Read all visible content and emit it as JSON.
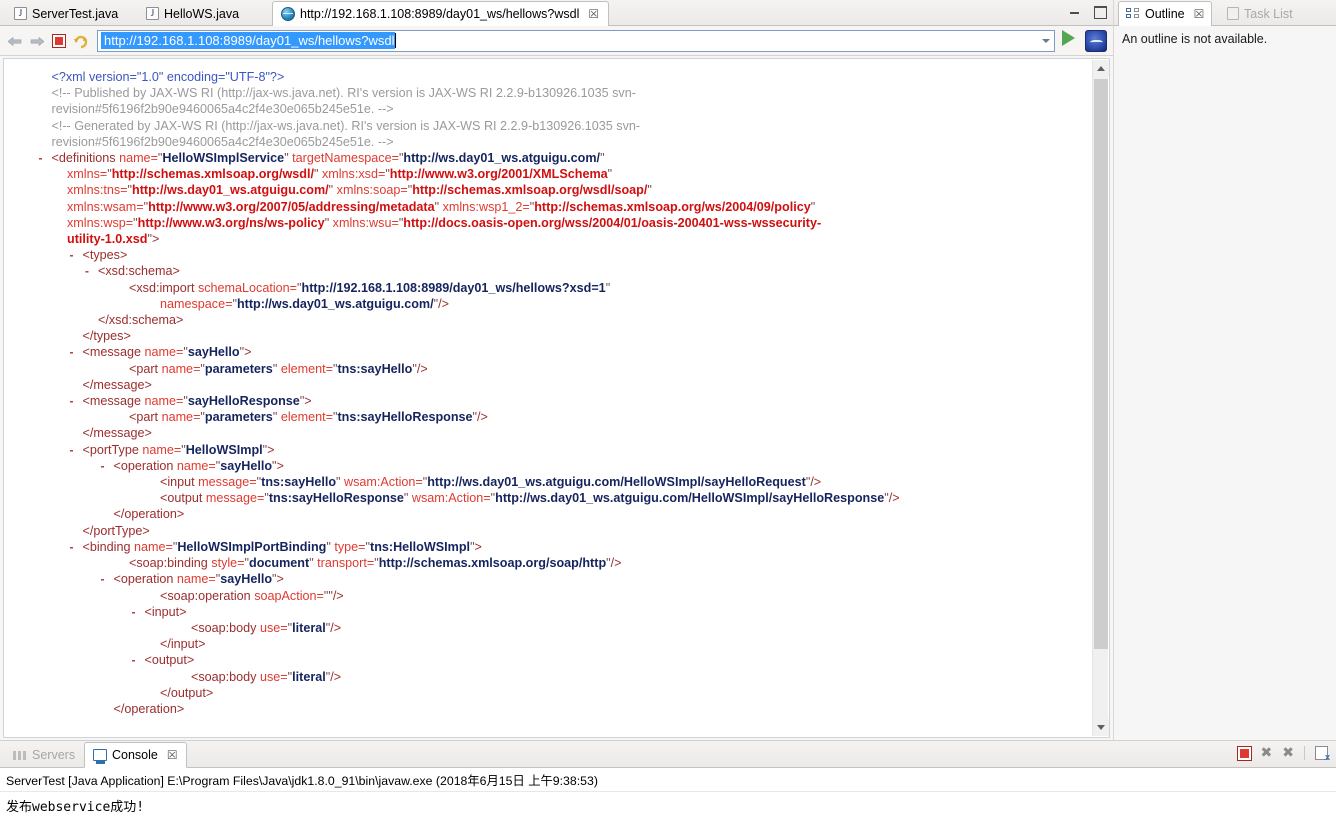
{
  "editor": {
    "tabs": [
      {
        "label": "ServerTest.java",
        "icon": "java-file-icon",
        "active": false,
        "closable": false
      },
      {
        "label": "HelloWS.java",
        "icon": "java-file-icon",
        "active": false,
        "closable": false
      },
      {
        "label": "http://192.168.1.108:8989/day01_ws/hellows?wsdl",
        "icon": "web-browser-icon",
        "active": true,
        "closable": true
      }
    ],
    "close_glyph": "☒"
  },
  "window_controls": {
    "minimize": "minimize-icon",
    "maximize": "maximize-icon"
  },
  "browser": {
    "back": "back-arrow-icon",
    "forward": "forward-arrow-icon",
    "stop": "stop-icon",
    "refresh": "refresh-icon",
    "address_value": "http://192.168.1.108:8989/day01_ws/hellows?wsdl",
    "address_dropdown": "chevron-down-icon",
    "go": "go-play-icon",
    "open_external": "open-in-browser-icon"
  },
  "xml": {
    "lines": [
      {
        "indent": 1,
        "collapse": "",
        "parts": [
          {
            "t": "<?xml version=\"1.0\" encoding=\"UTF-8\"?>",
            "c": "decl"
          }
        ]
      },
      {
        "indent": 1,
        "collapse": "",
        "parts": [
          {
            "t": "<!-- Published by JAX-WS RI (http://jax-ws.java.net). RI's version is JAX-WS RI 2.2.9-b130926.1035 svn-",
            "c": "cm"
          }
        ]
      },
      {
        "indent": 1,
        "collapse": "",
        "parts": [
          {
            "t": "revision#5f6196f2b90e9460065a4c2f4e30e065b245e51e. -->",
            "c": "cm"
          }
        ]
      },
      {
        "indent": 1,
        "collapse": "",
        "parts": [
          {
            "t": "<!-- Generated by JAX-WS RI (http://jax-ws.java.net). RI's version is JAX-WS RI 2.2.9-b130926.1035 svn-",
            "c": "cm"
          }
        ]
      },
      {
        "indent": 1,
        "collapse": "",
        "parts": [
          {
            "t": "revision#5f6196f2b90e9460065a4c2f4e30e065b245e51e. -->",
            "c": "cm"
          }
        ]
      },
      {
        "indent": 1,
        "collapse": "-",
        "parts": [
          {
            "t": "<definitions ",
            "c": "tg"
          },
          {
            "t": "name=",
            "c": "at"
          },
          {
            "t": "\"",
            "c": "qt"
          },
          {
            "t": "HelloWSImplService",
            "c": "vb"
          },
          {
            "t": "\" ",
            "c": "qt"
          },
          {
            "t": "targetNamespace=",
            "c": "at"
          },
          {
            "t": "\"",
            "c": "qt"
          },
          {
            "t": "http://ws.day01_ws.atguigu.com/",
            "c": "vb"
          },
          {
            "t": "\"",
            "c": "qt"
          }
        ]
      },
      {
        "indent": 2,
        "collapse": "",
        "parts": [
          {
            "t": "xmlns=",
            "c": "at"
          },
          {
            "t": "\"",
            "c": "qt"
          },
          {
            "t": "http://schemas.xmlsoap.org/wsdl/",
            "c": "vl"
          },
          {
            "t": "\" ",
            "c": "qt"
          },
          {
            "t": "xmlns:xsd=",
            "c": "at"
          },
          {
            "t": "\"",
            "c": "qt"
          },
          {
            "t": "http://www.w3.org/2001/XMLSchema",
            "c": "vl"
          },
          {
            "t": "\"",
            "c": "qt"
          }
        ]
      },
      {
        "indent": 2,
        "collapse": "",
        "parts": [
          {
            "t": "xmlns:tns=",
            "c": "at"
          },
          {
            "t": "\"",
            "c": "qt"
          },
          {
            "t": "http://ws.day01_ws.atguigu.com/",
            "c": "vl"
          },
          {
            "t": "\" ",
            "c": "qt"
          },
          {
            "t": "xmlns:soap=",
            "c": "at"
          },
          {
            "t": "\"",
            "c": "qt"
          },
          {
            "t": "http://schemas.xmlsoap.org/wsdl/soap/",
            "c": "vl"
          },
          {
            "t": "\"",
            "c": "qt"
          }
        ]
      },
      {
        "indent": 2,
        "collapse": "",
        "parts": [
          {
            "t": "xmlns:wsam=",
            "c": "at"
          },
          {
            "t": "\"",
            "c": "qt"
          },
          {
            "t": "http://www.w3.org/2007/05/addressing/metadata",
            "c": "vl"
          },
          {
            "t": "\" ",
            "c": "qt"
          },
          {
            "t": "xmlns:wsp1_2=",
            "c": "at"
          },
          {
            "t": "\"",
            "c": "qt"
          },
          {
            "t": "http://schemas.xmlsoap.org/ws/2004/09/policy",
            "c": "vl"
          },
          {
            "t": "\"",
            "c": "qt"
          }
        ]
      },
      {
        "indent": 2,
        "collapse": "",
        "parts": [
          {
            "t": "xmlns:wsp=",
            "c": "at"
          },
          {
            "t": "\"",
            "c": "qt"
          },
          {
            "t": "http://www.w3.org/ns/ws-policy",
            "c": "vl"
          },
          {
            "t": "\" ",
            "c": "qt"
          },
          {
            "t": "xmlns:wsu=",
            "c": "at"
          },
          {
            "t": "\"",
            "c": "qt"
          },
          {
            "t": "http://docs.oasis-open.org/wss/2004/01/oasis-200401-wss-wssecurity-",
            "c": "vl"
          }
        ]
      },
      {
        "indent": 2,
        "collapse": "",
        "parts": [
          {
            "t": "utility-1.0.xsd",
            "c": "vl"
          },
          {
            "t": "\"",
            "c": "qt"
          },
          {
            "t": ">",
            "c": "tg"
          }
        ]
      },
      {
        "indent": 3,
        "collapse": "-",
        "parts": [
          {
            "t": "<types>",
            "c": "tg"
          }
        ]
      },
      {
        "indent": 4,
        "collapse": "-",
        "parts": [
          {
            "t": "<xsd:schema>",
            "c": "tg"
          }
        ]
      },
      {
        "indent": 6,
        "collapse": "",
        "parts": [
          {
            "t": "<xsd:import ",
            "c": "tg"
          },
          {
            "t": "schemaLocation=",
            "c": "at"
          },
          {
            "t": "\"",
            "c": "qt"
          },
          {
            "t": "http://192.168.1.108:8989/day01_ws/hellows?xsd=1",
            "c": "vb"
          },
          {
            "t": "\"",
            "c": "qt"
          }
        ]
      },
      {
        "indent": 8,
        "collapse": "",
        "parts": [
          {
            "t": "namespace=",
            "c": "at"
          },
          {
            "t": "\"",
            "c": "qt"
          },
          {
            "t": "http://ws.day01_ws.atguigu.com/",
            "c": "vb"
          },
          {
            "t": "\"",
            "c": "qt"
          },
          {
            "t": "/>",
            "c": "tg"
          }
        ]
      },
      {
        "indent": 4,
        "collapse": "",
        "parts": [
          {
            "t": "</xsd:schema>",
            "c": "tg"
          }
        ]
      },
      {
        "indent": 3,
        "collapse": "",
        "parts": [
          {
            "t": "</types>",
            "c": "tg"
          }
        ]
      },
      {
        "indent": 3,
        "collapse": "-",
        "parts": [
          {
            "t": "<message ",
            "c": "tg"
          },
          {
            "t": "name=",
            "c": "at"
          },
          {
            "t": "\"",
            "c": "qt"
          },
          {
            "t": "sayHello",
            "c": "vb"
          },
          {
            "t": "\"",
            "c": "qt"
          },
          {
            "t": ">",
            "c": "tg"
          }
        ]
      },
      {
        "indent": 6,
        "collapse": "",
        "parts": [
          {
            "t": "<part ",
            "c": "tg"
          },
          {
            "t": "name=",
            "c": "at"
          },
          {
            "t": "\"",
            "c": "qt"
          },
          {
            "t": "parameters",
            "c": "vb"
          },
          {
            "t": "\" ",
            "c": "qt"
          },
          {
            "t": "element=",
            "c": "at"
          },
          {
            "t": "\"",
            "c": "qt"
          },
          {
            "t": "tns:sayHello",
            "c": "vb"
          },
          {
            "t": "\"",
            "c": "qt"
          },
          {
            "t": "/>",
            "c": "tg"
          }
        ]
      },
      {
        "indent": 3,
        "collapse": "",
        "parts": [
          {
            "t": "</message>",
            "c": "tg"
          }
        ]
      },
      {
        "indent": 3,
        "collapse": "-",
        "parts": [
          {
            "t": "<message ",
            "c": "tg"
          },
          {
            "t": "name=",
            "c": "at"
          },
          {
            "t": "\"",
            "c": "qt"
          },
          {
            "t": "sayHelloResponse",
            "c": "vb"
          },
          {
            "t": "\"",
            "c": "qt"
          },
          {
            "t": ">",
            "c": "tg"
          }
        ]
      },
      {
        "indent": 6,
        "collapse": "",
        "parts": [
          {
            "t": "<part ",
            "c": "tg"
          },
          {
            "t": "name=",
            "c": "at"
          },
          {
            "t": "\"",
            "c": "qt"
          },
          {
            "t": "parameters",
            "c": "vb"
          },
          {
            "t": "\" ",
            "c": "qt"
          },
          {
            "t": "element=",
            "c": "at"
          },
          {
            "t": "\"",
            "c": "qt"
          },
          {
            "t": "tns:sayHelloResponse",
            "c": "vb"
          },
          {
            "t": "\"",
            "c": "qt"
          },
          {
            "t": "/>",
            "c": "tg"
          }
        ]
      },
      {
        "indent": 3,
        "collapse": "",
        "parts": [
          {
            "t": "</message>",
            "c": "tg"
          }
        ]
      },
      {
        "indent": 3,
        "collapse": "-",
        "parts": [
          {
            "t": "<portType ",
            "c": "tg"
          },
          {
            "t": "name=",
            "c": "at"
          },
          {
            "t": "\"",
            "c": "qt"
          },
          {
            "t": "HelloWSImpl",
            "c": "vb"
          },
          {
            "t": "\"",
            "c": "qt"
          },
          {
            "t": ">",
            "c": "tg"
          }
        ]
      },
      {
        "indent": 5,
        "collapse": "-",
        "parts": [
          {
            "t": "<operation ",
            "c": "tg"
          },
          {
            "t": "name=",
            "c": "at"
          },
          {
            "t": "\"",
            "c": "qt"
          },
          {
            "t": "sayHello",
            "c": "vb"
          },
          {
            "t": "\"",
            "c": "qt"
          },
          {
            "t": ">",
            "c": "tg"
          }
        ]
      },
      {
        "indent": 8,
        "collapse": "",
        "parts": [
          {
            "t": "<input ",
            "c": "tg"
          },
          {
            "t": "message=",
            "c": "at"
          },
          {
            "t": "\"",
            "c": "qt"
          },
          {
            "t": "tns:sayHello",
            "c": "vb"
          },
          {
            "t": "\" ",
            "c": "qt"
          },
          {
            "t": "wsam:Action=",
            "c": "at"
          },
          {
            "t": "\"",
            "c": "qt"
          },
          {
            "t": "http://ws.day01_ws.atguigu.com/HelloWSImpl/sayHelloRequest",
            "c": "vb"
          },
          {
            "t": "\"",
            "c": "qt"
          },
          {
            "t": "/>",
            "c": "tg"
          }
        ]
      },
      {
        "indent": 8,
        "collapse": "",
        "parts": [
          {
            "t": "<output ",
            "c": "tg"
          },
          {
            "t": "message=",
            "c": "at"
          },
          {
            "t": "\"",
            "c": "qt"
          },
          {
            "t": "tns:sayHelloResponse",
            "c": "vb"
          },
          {
            "t": "\" ",
            "c": "qt"
          },
          {
            "t": "wsam:Action=",
            "c": "at"
          },
          {
            "t": "\"",
            "c": "qt"
          },
          {
            "t": "http://ws.day01_ws.atguigu.com/HelloWSImpl/sayHelloResponse",
            "c": "vb"
          },
          {
            "t": "\"",
            "c": "qt"
          },
          {
            "t": "/>",
            "c": "tg"
          }
        ]
      },
      {
        "indent": 5,
        "collapse": "",
        "parts": [
          {
            "t": "</operation>",
            "c": "tg"
          }
        ]
      },
      {
        "indent": 3,
        "collapse": "",
        "parts": [
          {
            "t": "</portType>",
            "c": "tg"
          }
        ]
      },
      {
        "indent": 3,
        "collapse": "-",
        "parts": [
          {
            "t": "<binding ",
            "c": "tg"
          },
          {
            "t": "name=",
            "c": "at"
          },
          {
            "t": "\"",
            "c": "qt"
          },
          {
            "t": "HelloWSImplPortBinding",
            "c": "vb"
          },
          {
            "t": "\" ",
            "c": "qt"
          },
          {
            "t": "type=",
            "c": "at"
          },
          {
            "t": "\"",
            "c": "qt"
          },
          {
            "t": "tns:HelloWSImpl",
            "c": "vb"
          },
          {
            "t": "\"",
            "c": "qt"
          },
          {
            "t": ">",
            "c": "tg"
          }
        ]
      },
      {
        "indent": 6,
        "collapse": "",
        "parts": [
          {
            "t": "<soap:binding ",
            "c": "tg"
          },
          {
            "t": "style=",
            "c": "at"
          },
          {
            "t": "\"",
            "c": "qt"
          },
          {
            "t": "document",
            "c": "vb"
          },
          {
            "t": "\" ",
            "c": "qt"
          },
          {
            "t": "transport=",
            "c": "at"
          },
          {
            "t": "\"",
            "c": "qt"
          },
          {
            "t": "http://schemas.xmlsoap.org/soap/http",
            "c": "vb"
          },
          {
            "t": "\"",
            "c": "qt"
          },
          {
            "t": "/>",
            "c": "tg"
          }
        ]
      },
      {
        "indent": 5,
        "collapse": "-",
        "parts": [
          {
            "t": "<operation ",
            "c": "tg"
          },
          {
            "t": "name=",
            "c": "at"
          },
          {
            "t": "\"",
            "c": "qt"
          },
          {
            "t": "sayHello",
            "c": "vb"
          },
          {
            "t": "\"",
            "c": "qt"
          },
          {
            "t": ">",
            "c": "tg"
          }
        ]
      },
      {
        "indent": 8,
        "collapse": "",
        "parts": [
          {
            "t": "<soap:operation ",
            "c": "tg"
          },
          {
            "t": "soapAction=",
            "c": "at"
          },
          {
            "t": "\"\"",
            "c": "qt"
          },
          {
            "t": "/>",
            "c": "tg"
          }
        ]
      },
      {
        "indent": 7,
        "collapse": "-",
        "parts": [
          {
            "t": "<input>",
            "c": "tg"
          }
        ]
      },
      {
        "indent": 10,
        "collapse": "",
        "parts": [
          {
            "t": "<soap:body ",
            "c": "tg"
          },
          {
            "t": "use=",
            "c": "at"
          },
          {
            "t": "\"",
            "c": "qt"
          },
          {
            "t": "literal",
            "c": "vb"
          },
          {
            "t": "\"",
            "c": "qt"
          },
          {
            "t": "/>",
            "c": "tg"
          }
        ]
      },
      {
        "indent": 8,
        "collapse": "",
        "parts": [
          {
            "t": "</input>",
            "c": "tg"
          }
        ]
      },
      {
        "indent": 7,
        "collapse": "-",
        "parts": [
          {
            "t": "<output>",
            "c": "tg"
          }
        ]
      },
      {
        "indent": 10,
        "collapse": "",
        "parts": [
          {
            "t": "<soap:body ",
            "c": "tg"
          },
          {
            "t": "use=",
            "c": "at"
          },
          {
            "t": "\"",
            "c": "qt"
          },
          {
            "t": "literal",
            "c": "vb"
          },
          {
            "t": "\"",
            "c": "qt"
          },
          {
            "t": "/>",
            "c": "tg"
          }
        ]
      },
      {
        "indent": 8,
        "collapse": "",
        "parts": [
          {
            "t": "</output>",
            "c": "tg"
          }
        ]
      },
      {
        "indent": 5,
        "collapse": "",
        "parts": [
          {
            "t": "</operation>",
            "c": "tg"
          }
        ]
      }
    ]
  },
  "right_panel": {
    "tabs": [
      {
        "label": "Outline",
        "icon": "outline-icon",
        "active": true,
        "closable": true
      },
      {
        "label": "Task List",
        "icon": "task-list-icon",
        "active": false,
        "closable": false
      }
    ],
    "close_glyph": "☒",
    "body_text": "An outline is not available."
  },
  "console": {
    "tabs": [
      {
        "label": "Servers",
        "icon": "servers-icon",
        "active": false,
        "closable": false
      },
      {
        "label": "Console",
        "icon": "console-icon",
        "active": true,
        "closable": true
      }
    ],
    "close_glyph": "☒",
    "tools": [
      {
        "name": "terminate-button",
        "glyph": ""
      },
      {
        "name": "remove-launch-button",
        "glyph": "✖"
      },
      {
        "name": "remove-all-terminated-button",
        "glyph": "✖"
      },
      {
        "name": "clear-console-button",
        "glyph": ""
      }
    ],
    "header": "ServerTest [Java Application] E:\\Program Files\\Java\\jdk1.8.0_91\\bin\\javaw.exe (2018年6月15日 上午9:38:53)",
    "output": "发布webservice成功!"
  },
  "colors": {
    "selection_blue": "#3399ff",
    "attr_value_red": "#d10f0f",
    "attr_value_navy": "#16245e",
    "tag_maroon": "#9b2d2d",
    "attr_name_red": "#e03a30",
    "comment_grey": "#9a9a9a",
    "decl_blue": "#3a56c0"
  }
}
